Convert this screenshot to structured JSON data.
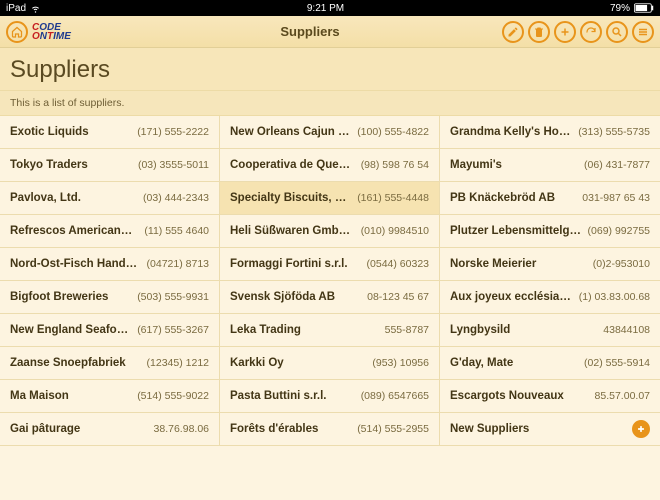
{
  "statusbar": {
    "device": "iPad",
    "time": "9:21 PM",
    "battery": "79%"
  },
  "header": {
    "logo_line1": "CODE",
    "logo_line2": "ONTIME",
    "title": "Suppliers"
  },
  "page": {
    "title": "Suppliers",
    "subtitle": "This is a list of suppliers."
  },
  "suppliers": [
    [
      {
        "name": "Exotic Liquids",
        "phone": "(171) 555-2222"
      },
      {
        "name": "New Orleans Cajun Deli...",
        "phone": "(100) 555-4822"
      },
      {
        "name": "Grandma Kelly's Homes...",
        "phone": "(313) 555-5735"
      }
    ],
    [
      {
        "name": "Tokyo Traders",
        "phone": "(03) 3555-5011"
      },
      {
        "name": "Cooperativa de Quesos ...",
        "phone": "(98) 598 76 54"
      },
      {
        "name": "Mayumi's",
        "phone": "(06) 431-7877"
      }
    ],
    [
      {
        "name": "Pavlova, Ltd.",
        "phone": "(03) 444-2343"
      },
      {
        "name": "Specialty Biscuits, Ltd.",
        "phone": "(161) 555-4448",
        "highlight": true
      },
      {
        "name": "PB Knäckebröd AB",
        "phone": "031-987 65 43"
      }
    ],
    [
      {
        "name": "Refrescos Americanas ...",
        "phone": "(11) 555 4640"
      },
      {
        "name": "Heli Süßwaren GmbH & ...",
        "phone": "(010) 9984510"
      },
      {
        "name": "Plutzer Lebensmittelgro...",
        "phone": "(069) 992755"
      }
    ],
    [
      {
        "name": "Nord-Ost-Fisch Handels...",
        "phone": "(04721) 8713"
      },
      {
        "name": "Formaggi Fortini s.r.l.",
        "phone": "(0544) 60323"
      },
      {
        "name": "Norske Meierier",
        "phone": "(0)2-953010"
      }
    ],
    [
      {
        "name": "Bigfoot Breweries",
        "phone": "(503) 555-9931"
      },
      {
        "name": "Svensk Sjöföda AB",
        "phone": "08-123 45 67"
      },
      {
        "name": "Aux joyeux ecclésiastiq...",
        "phone": "(1) 03.83.00.68"
      }
    ],
    [
      {
        "name": "New England Seafood ...",
        "phone": "(617) 555-3267"
      },
      {
        "name": "Leka Trading",
        "phone": "555-8787"
      },
      {
        "name": "Lyngbysild",
        "phone": "43844108"
      }
    ],
    [
      {
        "name": "Zaanse Snoepfabriek",
        "phone": "(12345) 1212"
      },
      {
        "name": "Karkki Oy",
        "phone": "(953) 10956"
      },
      {
        "name": "G'day, Mate",
        "phone": "(02) 555-5914"
      }
    ],
    [
      {
        "name": "Ma Maison",
        "phone": "(514) 555-9022"
      },
      {
        "name": "Pasta Buttini s.r.l.",
        "phone": "(089) 6547665"
      },
      {
        "name": "Escargots Nouveaux",
        "phone": "85.57.00.07"
      }
    ],
    [
      {
        "name": "Gai pâturage",
        "phone": "38.76.98.06"
      },
      {
        "name": "Forêts d'érables",
        "phone": "(514) 555-2955"
      },
      {
        "name": "New Suppliers",
        "add": true
      }
    ]
  ]
}
